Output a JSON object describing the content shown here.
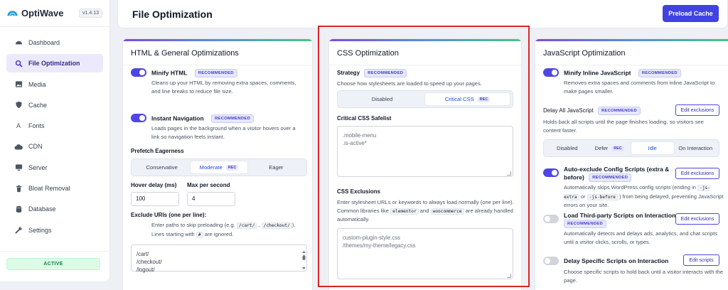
{
  "app": {
    "name": "OptiWave",
    "version": "v1.4.13",
    "status": "ACTIVE"
  },
  "sidebar": {
    "items": [
      {
        "label": "Dashboard",
        "icon": "dashboard-icon",
        "active": false
      },
      {
        "label": "File Optimization",
        "icon": "search-icon",
        "active": true
      },
      {
        "label": "Media",
        "icon": "image-icon",
        "active": false
      },
      {
        "label": "Cache",
        "icon": "shield-icon",
        "active": false
      },
      {
        "label": "Fonts",
        "icon": "font-icon",
        "active": false
      },
      {
        "label": "CDN",
        "icon": "cloud-icon",
        "active": false
      },
      {
        "label": "Server",
        "icon": "monitor-icon",
        "active": false
      },
      {
        "label": "Bloat Removal",
        "icon": "trash-icon",
        "active": false
      },
      {
        "label": "Database",
        "icon": "database-icon",
        "active": false
      },
      {
        "label": "Settings",
        "icon": "wrench-icon",
        "active": false
      }
    ]
  },
  "header": {
    "title": "File Optimization",
    "action": "Preload Cache"
  },
  "recommended": "RECOMMENDED",
  "rec_short": "REC",
  "html_card": {
    "title": "HTML & General Optimizations",
    "minify": {
      "title": "Minify HTML",
      "on": true,
      "desc": "Cleans up your HTML by removing extra spaces, comments, and line breaks to reduce file size."
    },
    "instant": {
      "title": "Instant Navigation",
      "on": true,
      "desc": "Loads pages in the background when a visitor hovers over a link so navigation feels instant."
    },
    "prefetch": {
      "label": "Prefetch Eagerness",
      "options": [
        "Conservative",
        "Moderate",
        "Eager"
      ],
      "selected": "Moderate"
    },
    "hover_delay": {
      "label": "Hover delay (ms)",
      "value": "100"
    },
    "max_per_second": {
      "label": "Max per second",
      "value": "4"
    },
    "exclude": {
      "label": "Exclude URIs (one per line):",
      "desc_1": "Enter paths to skip preloading (e.g.",
      "code_1": "/cart/",
      "code_2": "/checkout/",
      "desc_2": "). Lines starting with",
      "code_3": "#",
      "desc_3": "are ignored.",
      "value": "/cart/\n/checkout/\n/logout/"
    }
  },
  "css_card": {
    "title": "CSS Optimization",
    "strategy_label": "Strategy",
    "strategy_desc": "Choose how stylesheets are loaded to speed up your pages.",
    "strategy_options": [
      "Disabled",
      "Critical CSS"
    ],
    "strategy_selected": "Critical CSS",
    "safelist_label": "Critical CSS Safelist",
    "safelist_value": ".mobile-menu\n.is-active*",
    "exclusions_label": "CSS Exclusions",
    "exclusions_desc_1": "Enter stylesheet URLs or keywords to always load normally (one per line). Common libraries like",
    "exclusions_code_1": "elementor",
    "exclusions_desc_2": "and",
    "exclusions_code_2": "woocommerce",
    "exclusions_desc_3": "are already handled automatically.",
    "exclusions_value": "custom-plugin-style.css\n/themes/my-theme/legacy.css"
  },
  "js_card": {
    "title": "JavaScript Optimization",
    "minify": {
      "title": "Minify Inline JavaScript",
      "on": true,
      "desc": "Removes extra spaces and comments from inline JavaScript to make pages smaller."
    },
    "delay": {
      "label": "Delay All JavaScript",
      "button": "Edit exclusions",
      "desc": "Holds back all scripts until the page finishes loading, so visitors see content faster.",
      "options": [
        "Disabled",
        "Defer",
        "Idle",
        "On Interaction"
      ],
      "selected": "Idle"
    },
    "auto_exclude": {
      "title_1": "Auto-exclude Config Scripts (extra &",
      "title_2": "before)",
      "on": true,
      "button": "Edit exclusions",
      "desc_1": "Automatically skips WordPress config scripts (ending in",
      "code_1": "-js-extra",
      "desc_2": "or",
      "code_2": "-js-before",
      "desc_3": ") from being delayed, preventing JavaScript errors on your site."
    },
    "third_party": {
      "title": "Load Third-party Scripts on Interaction",
      "on": false,
      "button": "Edit exclusions",
      "desc": "Automatically detects and delays ads, analytics, and chat scripts until a visitor clicks, scrolls, or types."
    },
    "specific": {
      "title": "Delay Specific Scripts on Interaction",
      "on": false,
      "button": "Edit scripts",
      "desc": "Choose specific scripts to hold back until a visitor interacts with the page."
    }
  },
  "colors": {
    "accent": "#4f46e5",
    "primary_button": "#4042e2",
    "highlight": "#d92626",
    "active_green": "#15803d"
  }
}
